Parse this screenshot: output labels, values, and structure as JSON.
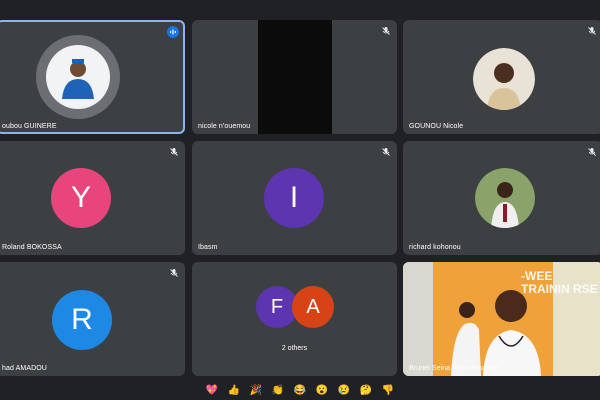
{
  "participants": [
    {
      "name": "oubou GUINERE",
      "type": "photo",
      "speaking": true
    },
    {
      "name": "nicole n'ouemou",
      "type": "video-dark"
    },
    {
      "name": "GOUNOU Nicole",
      "type": "photo"
    },
    {
      "name": "Roland BOKOSSA",
      "type": "letter",
      "letter": "Y",
      "color": "#e8457c"
    },
    {
      "name": "Ibasm",
      "type": "letter",
      "letter": "I",
      "color": "#5e35b1"
    },
    {
      "name": "richard kohonou",
      "type": "photo"
    },
    {
      "name": "had AMADOU",
      "type": "letter",
      "letter": "R",
      "color": "#1e88e5"
    },
    {
      "name": "2 others",
      "type": "group",
      "letters": [
        "F",
        "A"
      ],
      "colors": [
        "#5e35b1",
        "#d84315"
      ]
    },
    {
      "name": "Brunel Seina Roch Fossane",
      "type": "video"
    }
  ],
  "video_banner_text": "-WEE TRAININ RSE",
  "reactions": [
    "💖",
    "👍",
    "🎉",
    "👏",
    "😂",
    "😮",
    "😢",
    "🤔",
    "👎"
  ]
}
